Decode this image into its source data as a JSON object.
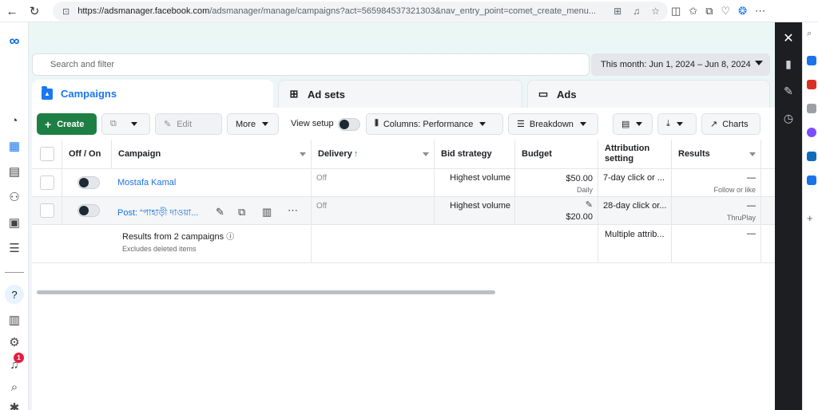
{
  "browser": {
    "url_host": "https://adsmanager.facebook.com",
    "url_rest": "/adsmanager/manage/campaigns?act=565984537321303&nav_entry_point=comet_create_menu..."
  },
  "search": {
    "placeholder": "Search and filter"
  },
  "date_range": {
    "label": "This month: Jun 1, 2024 – Jun 8, 2024"
  },
  "tabs": [
    {
      "label": "Campaigns",
      "active": true
    },
    {
      "label": "Ad sets",
      "active": false
    },
    {
      "label": "Ads",
      "active": false
    }
  ],
  "toolbar": {
    "create_label": "Create",
    "edit_label": "Edit",
    "more_label": "More",
    "view_setup_label": "View setup",
    "columns_label": "Columns: Performance",
    "breakdown_label": "Breakdown",
    "charts_label": "Charts"
  },
  "columns": {
    "off_on": "Off / On",
    "campaign": "Campaign",
    "delivery": "Delivery",
    "delivery_arrow": "↑",
    "bid_strategy": "Bid strategy",
    "budget": "Budget",
    "attribution": "Attribution setting",
    "results": "Results"
  },
  "rows": [
    {
      "campaign": "Mostafa Kamal",
      "delivery": "Off",
      "bid_strategy": "Highest volume",
      "budget": "$50.00",
      "budget_period": "Daily",
      "attribution": "7-day click or ...",
      "results": "—",
      "results_sub": "Follow or like"
    },
    {
      "campaign": "Post: “পাহাড়ী দাওয়া...",
      "delivery": "Off",
      "bid_strategy": "Highest volume",
      "budget": "$20.00",
      "attribution": "28-day click or...",
      "results": "—",
      "results_sub": "ThruPlay"
    }
  ],
  "summary": {
    "title": "Results from 2 campaigns",
    "subtitle": "Excludes deleted items",
    "attribution": "Multiple attrib...",
    "results": "—"
  },
  "notifications": {
    "count": "1"
  }
}
